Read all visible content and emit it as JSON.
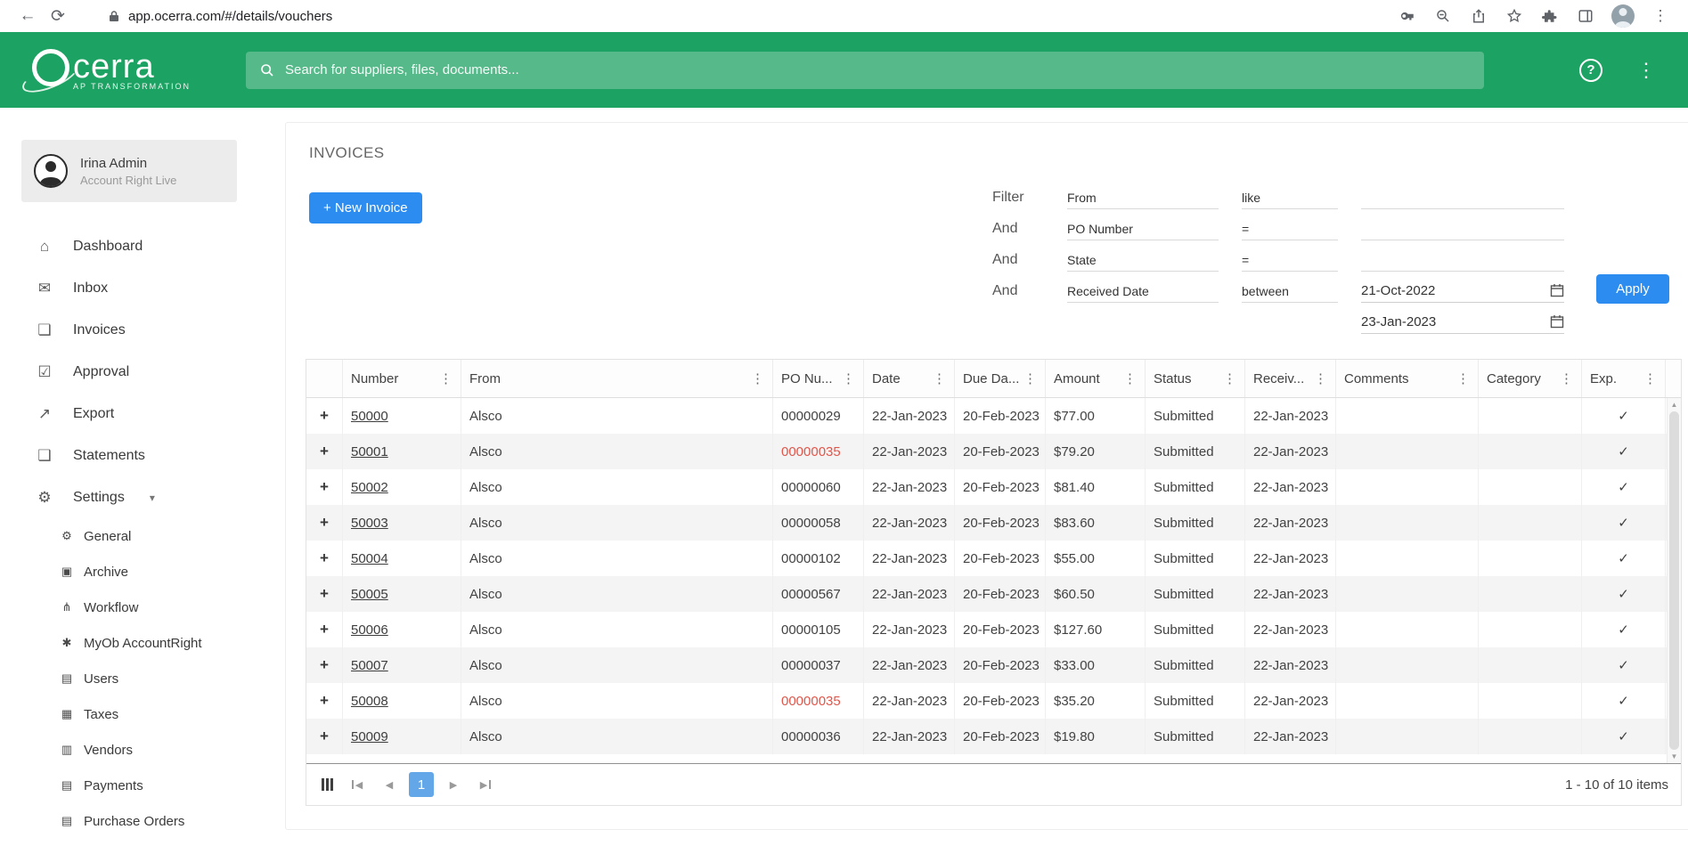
{
  "colors": {
    "brand_green": "#1CA262",
    "accent_blue": "#2D8CF0",
    "po_alert_red": "#E0564A"
  },
  "browser": {
    "url": "app.ocerra.com/#/details/vouchers"
  },
  "header": {
    "logo_text": "cerra",
    "logo_tagline": "AP TRANSFORMATION",
    "search_placeholder": "Search for suppliers, files, documents..."
  },
  "sidebar": {
    "user_name": "Irina Admin",
    "user_subtitle": "Account Right Live",
    "items": [
      {
        "label": "Dashboard",
        "icon": "home-icon"
      },
      {
        "label": "Inbox",
        "icon": "inbox-icon"
      },
      {
        "label": "Invoices",
        "icon": "invoices-icon"
      },
      {
        "label": "Approval",
        "icon": "approval-icon"
      },
      {
        "label": "Export",
        "icon": "export-icon"
      },
      {
        "label": "Statements",
        "icon": "statements-icon"
      },
      {
        "label": "Settings",
        "icon": "settings-icon",
        "expanded": true
      }
    ],
    "settings_children": [
      {
        "label": "General",
        "icon": "gear-icon"
      },
      {
        "label": "Archive",
        "icon": "archive-icon"
      },
      {
        "label": "Workflow",
        "icon": "workflow-icon"
      },
      {
        "label": "MyOb AccountRight",
        "icon": "myob-icon"
      },
      {
        "label": "Users",
        "icon": "users-icon"
      },
      {
        "label": "Taxes",
        "icon": "taxes-icon"
      },
      {
        "label": "Vendors",
        "icon": "vendors-icon"
      },
      {
        "label": "Payments",
        "icon": "payments-icon"
      },
      {
        "label": "Purchase Orders",
        "icon": "purchase-orders-icon"
      }
    ]
  },
  "main": {
    "title": "INVOICES",
    "new_invoice_label": "+ New Invoice",
    "filter": {
      "apply_label": "Apply",
      "rows": [
        {
          "conj": "Filter",
          "field": "From",
          "operator": "like",
          "value": ""
        },
        {
          "conj": "And",
          "field": "PO Number",
          "operator": "=",
          "value": ""
        },
        {
          "conj": "And",
          "field": "State",
          "operator": "=",
          "value": ""
        },
        {
          "conj": "And",
          "field": "Received Date",
          "operator": "between",
          "value": "21-Oct-2022",
          "value2": "23-Jan-2023"
        }
      ]
    },
    "table": {
      "columns": [
        {
          "label": "",
          "key": "expand"
        },
        {
          "label": "Number",
          "key": "number"
        },
        {
          "label": "From",
          "key": "from"
        },
        {
          "label": "PO Nu...",
          "key": "po-number"
        },
        {
          "label": "Date",
          "key": "date"
        },
        {
          "label": "Due Da...",
          "key": "due-date"
        },
        {
          "label": "Amount",
          "key": "amount"
        },
        {
          "label": "Status",
          "key": "status"
        },
        {
          "label": "Receiv...",
          "key": "received"
        },
        {
          "label": "Comments",
          "key": "comments"
        },
        {
          "label": "Category",
          "key": "category"
        },
        {
          "label": "Exp.",
          "key": "exported"
        }
      ],
      "rows": [
        {
          "number": "50000",
          "from": "Alsco",
          "po": "00000029",
          "po_alert": false,
          "date": "22-Jan-2023",
          "due_date": "20-Feb-2023",
          "amount": "$77.00",
          "status": "Submitted",
          "received": "22-Jan-2023",
          "comments": "",
          "category": "",
          "exported": true
        },
        {
          "number": "50001",
          "from": "Alsco",
          "po": "00000035",
          "po_alert": true,
          "date": "22-Jan-2023",
          "due_date": "20-Feb-2023",
          "amount": "$79.20",
          "status": "Submitted",
          "received": "22-Jan-2023",
          "comments": "",
          "category": "",
          "exported": true
        },
        {
          "number": "50002",
          "from": "Alsco",
          "po": "00000060",
          "po_alert": false,
          "date": "22-Jan-2023",
          "due_date": "20-Feb-2023",
          "amount": "$81.40",
          "status": "Submitted",
          "received": "22-Jan-2023",
          "comments": "",
          "category": "",
          "exported": true
        },
        {
          "number": "50003",
          "from": "Alsco",
          "po": "00000058",
          "po_alert": false,
          "date": "22-Jan-2023",
          "due_date": "20-Feb-2023",
          "amount": "$83.60",
          "status": "Submitted",
          "received": "22-Jan-2023",
          "comments": "",
          "category": "",
          "exported": true
        },
        {
          "number": "50004",
          "from": "Alsco",
          "po": "00000102",
          "po_alert": false,
          "date": "22-Jan-2023",
          "due_date": "20-Feb-2023",
          "amount": "$55.00",
          "status": "Submitted",
          "received": "22-Jan-2023",
          "comments": "",
          "category": "",
          "exported": true
        },
        {
          "number": "50005",
          "from": "Alsco",
          "po": "00000567",
          "po_alert": false,
          "date": "22-Jan-2023",
          "due_date": "20-Feb-2023",
          "amount": "$60.50",
          "status": "Submitted",
          "received": "22-Jan-2023",
          "comments": "",
          "category": "",
          "exported": true
        },
        {
          "number": "50006",
          "from": "Alsco",
          "po": "00000105",
          "po_alert": false,
          "date": "22-Jan-2023",
          "due_date": "20-Feb-2023",
          "amount": "$127.60",
          "status": "Submitted",
          "received": "22-Jan-2023",
          "comments": "",
          "category": "",
          "exported": true
        },
        {
          "number": "50007",
          "from": "Alsco",
          "po": "00000037",
          "po_alert": false,
          "date": "22-Jan-2023",
          "due_date": "20-Feb-2023",
          "amount": "$33.00",
          "status": "Submitted",
          "received": "22-Jan-2023",
          "comments": "",
          "category": "",
          "exported": true
        },
        {
          "number": "50008",
          "from": "Alsco",
          "po": "00000035",
          "po_alert": true,
          "date": "22-Jan-2023",
          "due_date": "20-Feb-2023",
          "amount": "$35.20",
          "status": "Submitted",
          "received": "22-Jan-2023",
          "comments": "",
          "category": "",
          "exported": true
        },
        {
          "number": "50009",
          "from": "Alsco",
          "po": "00000036",
          "po_alert": false,
          "date": "22-Jan-2023",
          "due_date": "20-Feb-2023",
          "amount": "$19.80",
          "status": "Submitted",
          "received": "22-Jan-2023",
          "comments": "",
          "category": "",
          "exported": true
        }
      ]
    },
    "pagination": {
      "current_page": "1",
      "summary": "1 - 10 of 10 items"
    }
  }
}
